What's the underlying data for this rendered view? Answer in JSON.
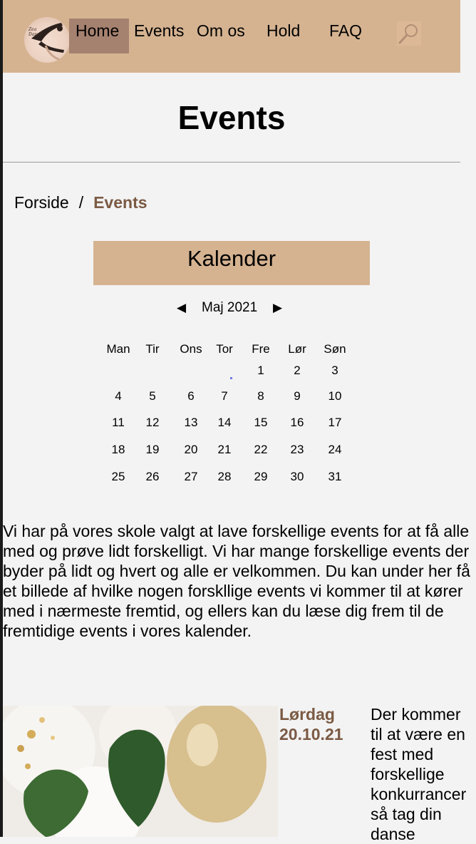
{
  "header": {
    "logo_text": "Zea Dance",
    "nav": [
      "Home",
      "Events",
      "Om os",
      "Hold",
      "FAQ"
    ],
    "active": "Home"
  },
  "page": {
    "title": "Events"
  },
  "breadcrumb": {
    "home": "Forside",
    "separator": "/",
    "current": "Events"
  },
  "calendar": {
    "title": "Kalender",
    "month_label": "Maj 2021",
    "prev_symbol": "◀",
    "next_symbol": "▶",
    "day_names": [
      "Man",
      "Tir",
      "Ons",
      "Tor",
      "Fre",
      "Lør",
      "Søn"
    ],
    "weeks": [
      [
        "",
        "",
        "",
        "",
        "1",
        "2",
        "3"
      ],
      [
        "4",
        "5",
        "6",
        "7",
        "8",
        "9",
        "10"
      ],
      [
        "11",
        "12",
        "13",
        "14",
        "15",
        "16",
        "17"
      ],
      [
        "18",
        "19",
        "20",
        "21",
        "22",
        "23",
        "24"
      ],
      [
        "25",
        "26",
        "27",
        "28",
        "29",
        "30",
        "31"
      ]
    ]
  },
  "intro": "Vi har på vores skole valgt at lave forskellige events for at få alle med og prøve lidt forskelligt. Vi har mange forskellige events der byder på lidt og hvert og alle er velkommen. Du kan under her få et billede af hvilke nogen forskllige events vi kommer til at kører med i nærmeste fremtid, og ellers kan du læse dig frem til de fremtidige events i vores kalender.",
  "event": {
    "day": "Lørdag",
    "date": "20.10.21",
    "description": "Der kommer til at være en fest med forskellige konkurrancer så tag din danse"
  },
  "colors": {
    "header_bg": "#d5b391",
    "nav_active_bg": "#a58170",
    "accent_text": "#7b5a44",
    "page_bg": "#f3f3f3"
  }
}
